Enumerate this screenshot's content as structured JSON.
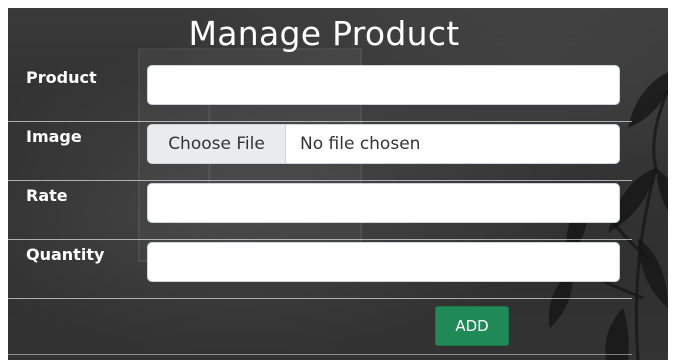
{
  "page_title": "Manage Product",
  "form": {
    "product": {
      "label": "Product",
      "value": ""
    },
    "image": {
      "label": "Image",
      "button_label": "Choose File",
      "status": "No file chosen"
    },
    "rate": {
      "label": "Rate",
      "value": ""
    },
    "quantity": {
      "label": "Quantity",
      "value": ""
    },
    "submit_label": "ADD"
  },
  "colors": {
    "panel_background": "#2f2f2f",
    "add_button": "#1f8a55",
    "text": "#ffffff"
  }
}
